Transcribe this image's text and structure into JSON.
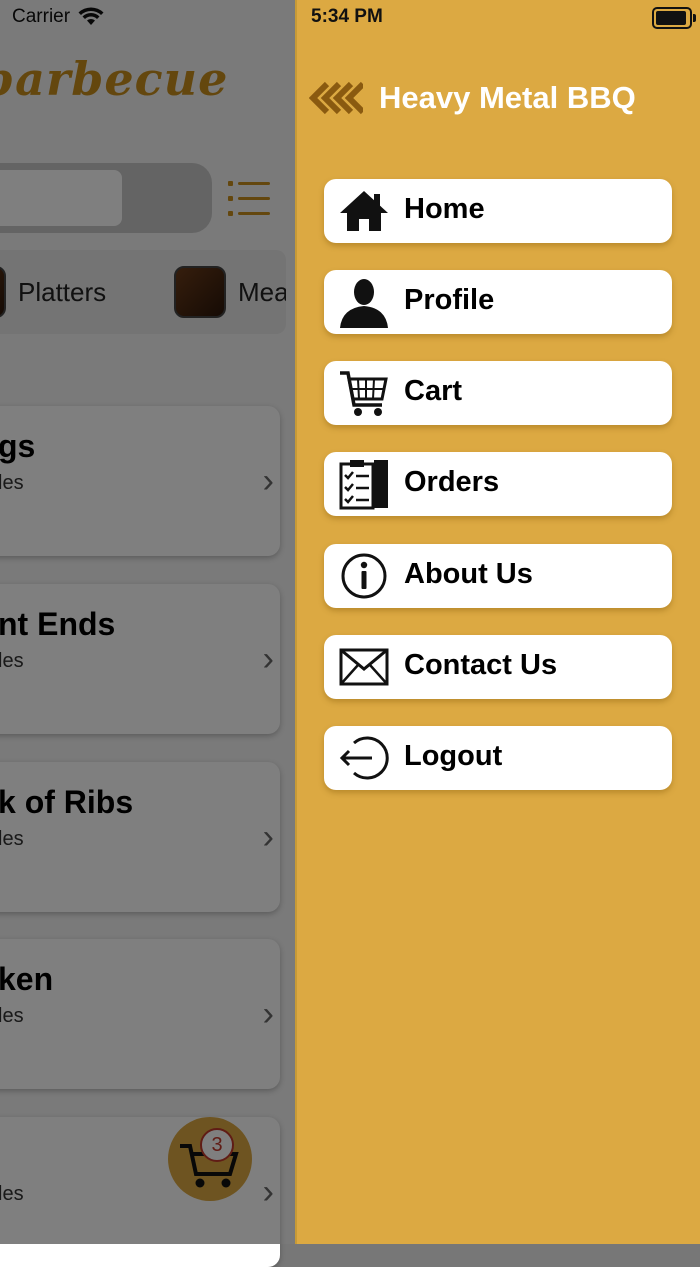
{
  "status": {
    "carrier": "Carrier",
    "time": "5:34 PM"
  },
  "background": {
    "brand": "barbecue",
    "categories": [
      {
        "label": "Platters"
      },
      {
        "label": "Mea"
      }
    ],
    "cards": [
      {
        "title": "gs",
        "subtitle": "les"
      },
      {
        "title": "nt Ends",
        "subtitle": "les"
      },
      {
        "title": "k of Ribs",
        "subtitle": "les"
      },
      {
        "title": "ken",
        "subtitle": "les"
      },
      {
        "title": "",
        "subtitle": "les"
      }
    ],
    "cart_count": "3"
  },
  "drawer": {
    "title": "Heavy Metal BBQ",
    "accent_color": "#dca942",
    "items": [
      {
        "label": "Home",
        "icon": "home-icon"
      },
      {
        "label": "Profile",
        "icon": "person-icon"
      },
      {
        "label": "Cart",
        "icon": "cart-icon"
      },
      {
        "label": "Orders",
        "icon": "clipboard-icon"
      },
      {
        "label": "About Us",
        "icon": "info-icon"
      },
      {
        "label": "Contact Us",
        "icon": "envelope-icon"
      },
      {
        "label": "Logout",
        "icon": "logout-icon"
      }
    ]
  }
}
